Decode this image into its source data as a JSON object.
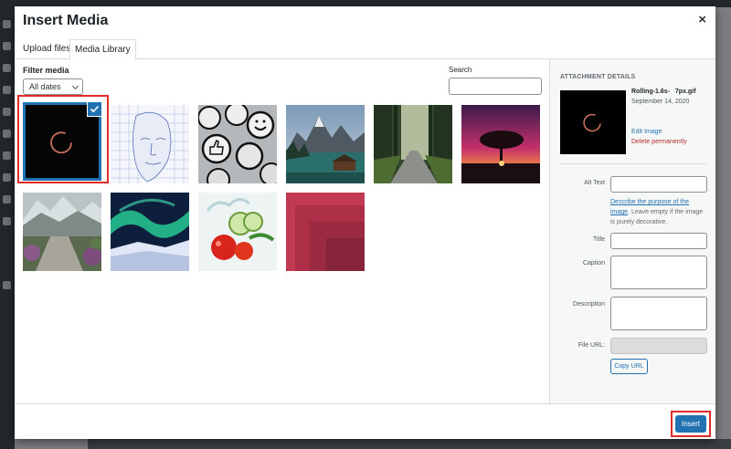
{
  "modal": {
    "title": "Insert Media",
    "close_glyph": "×",
    "tabs": [
      {
        "label": "Upload files",
        "active": false
      },
      {
        "label": "Media Library",
        "active": true
      }
    ]
  },
  "browser": {
    "filter_label": "Filter media",
    "date_filter": "All dates",
    "search_label": "Search",
    "search_value": "",
    "items": [
      {
        "name": "rolling-spinner",
        "selected": true
      },
      {
        "name": "wireframe-face",
        "selected": false
      },
      {
        "name": "icon-buttons",
        "selected": false
      },
      {
        "name": "mountain-lake-cabin",
        "selected": false
      },
      {
        "name": "forest-road",
        "selected": false
      },
      {
        "name": "tree-sunset",
        "selected": false
      },
      {
        "name": "snowy-mountain-path",
        "selected": false
      },
      {
        "name": "aurora-snow",
        "selected": false
      },
      {
        "name": "vegetables-splash",
        "selected": false
      },
      {
        "name": "red-squares",
        "selected": false
      }
    ]
  },
  "attachment": {
    "heading": "ATTACHMENT DETAILS",
    "filename": "Rolling-1.6s-   7px.gif",
    "date": "September 14, 2020",
    "edit_link": "Edit Image",
    "delete_link": "Delete permanently",
    "fields": {
      "alt_text": {
        "label": "Alt Text",
        "value": ""
      },
      "title": {
        "label": "Title",
        "value": ""
      },
      "caption": {
        "label": "Caption",
        "value": ""
      },
      "description": {
        "label": "Description",
        "value": ""
      },
      "file_url": {
        "label": "File URL:",
        "value": ""
      }
    },
    "alt_help_link": "Describe the purpose of the image",
    "alt_help_rest": ". Leave empty if the image is purely decorative.",
    "copy_url_button": "Copy URL"
  },
  "footer": {
    "insert_button": "Insert"
  },
  "colors": {
    "accent": "#2271b1",
    "danger": "#b32d2e",
    "highlight_box": "#e02b27"
  }
}
